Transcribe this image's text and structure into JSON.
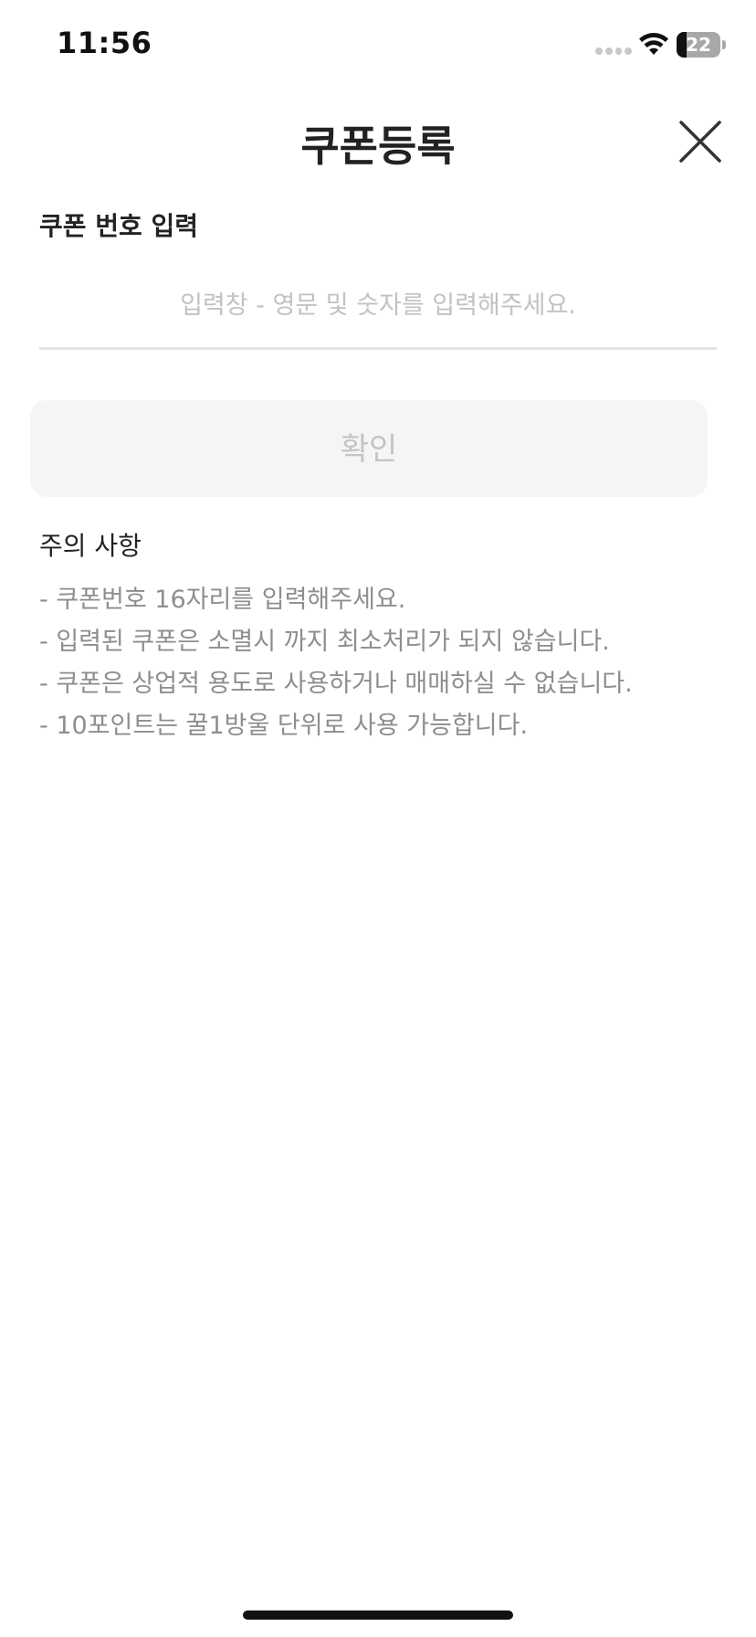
{
  "status_bar": {
    "time": "11:56",
    "battery_level": "22",
    "battery_fraction": 0.22,
    "icons": [
      "signal-dots-icon",
      "wifi-icon",
      "battery-icon"
    ]
  },
  "header": {
    "title": "쿠폰등록",
    "close_icon": "close-icon"
  },
  "coupon_form": {
    "label": "쿠폰 번호 입력",
    "input_value": "",
    "input_placeholder": "입력창 - 영문 및 숫자를 입력해주세요.",
    "confirm_label": "확인"
  },
  "notice": {
    "title": "주의 사항",
    "items": [
      "- 쿠폰번호 16자리를 입력해주세요.",
      "- 입력된 쿠폰은 소멸시 까지 최소처리가 되지 않습니다.",
      "- 쿠폰은 상업적 용도로 사용하거나 매매하실 수 없습니다.",
      "- 10포인트는 꿀1방울 단위로 사용 가능합니다."
    ]
  },
  "colors": {
    "title_text": "#222222",
    "placeholder_text": "#c2c2c2",
    "notice_text": "#8e8e8e",
    "button_background": "#f5f5f5",
    "button_text": "#c4c4c4",
    "divider": "#e4e4e4"
  }
}
